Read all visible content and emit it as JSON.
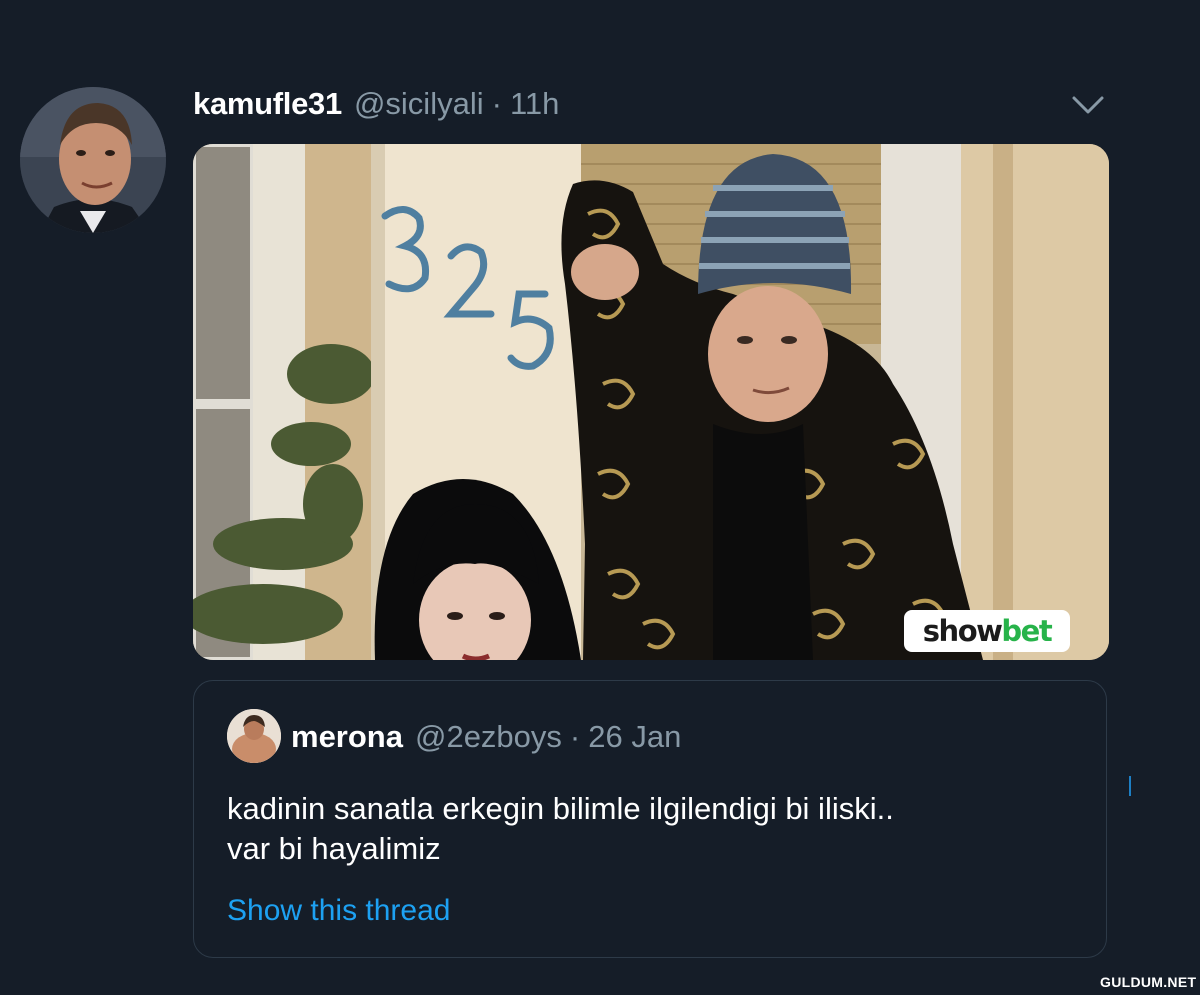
{
  "tweet": {
    "display_name": "kamufle31",
    "handle": "@sicilyali",
    "separator": "·",
    "time": "11h",
    "menu_icon": "chevron-down-icon",
    "media": {
      "house_number": "325",
      "logo_text_part1": "show",
      "logo_text_part2": "bet",
      "logo_colors": {
        "dark": "#1b1b1b",
        "green": "#27b34a"
      }
    }
  },
  "quoted_tweet": {
    "display_name": "merona",
    "handle": "@2ezboys",
    "separator": "·",
    "date": "26 Jan",
    "text": "kadinin sanatla erkegin bilimle  ilgilendigi bi iliski..\nvar bi hayalimiz",
    "show_thread": "Show this thread"
  },
  "watermark": "GULDUM.NET",
  "colors": {
    "background": "#151d28",
    "secondary_text": "#8899a6",
    "link": "#1da1f2",
    "border": "#2d3a48"
  }
}
